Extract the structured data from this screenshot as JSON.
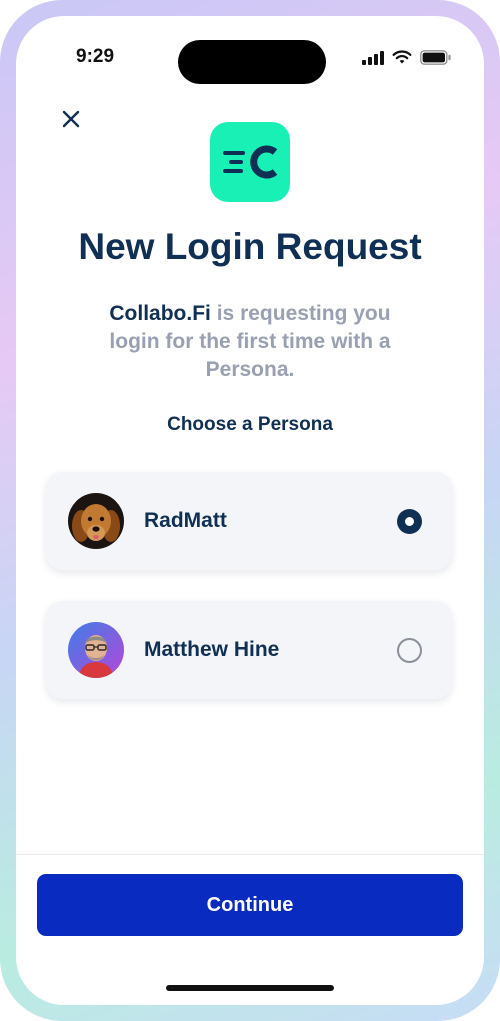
{
  "status_bar": {
    "time": "9:29"
  },
  "icons": {
    "close": "close-icon",
    "logo": "collabo-logo-icon",
    "signal": "cellular-signal-icon",
    "wifi": "wifi-icon",
    "battery": "battery-icon"
  },
  "header": {
    "title": "New Login Request",
    "app_name": "Collabo.Fi",
    "subtitle_rest": " is requesting you login for the first time with a Persona."
  },
  "choose_label": "Choose a Persona",
  "personas": [
    {
      "name": "RadMatt",
      "selected": true
    },
    {
      "name": "Matthew Hine",
      "selected": false
    }
  ],
  "footer": {
    "continue_label": "Continue"
  },
  "colors": {
    "accent": "#19f0b5",
    "primary_button": "#0a2bbf",
    "heading": "#0f2f55",
    "muted_text": "#9aa0b3"
  }
}
